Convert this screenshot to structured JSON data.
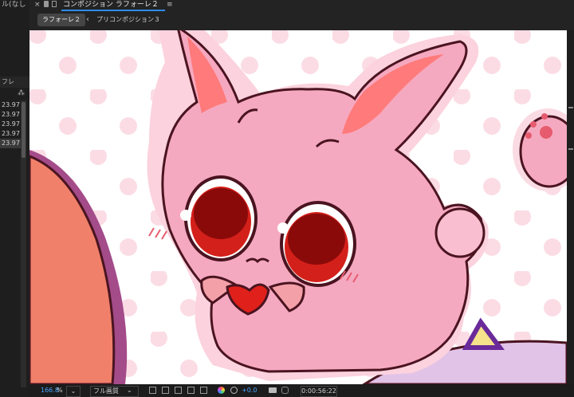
{
  "left_panel": {
    "top_text": "ル(なし",
    "column_header": "フレ",
    "fps_values": [
      "23.97",
      "23.97",
      "23.97",
      "23.97",
      "23.97"
    ]
  },
  "header": {
    "tab_title": "コンポジション ラフォーレ２",
    "breadcrumb_active": "ラフォーレ２",
    "breadcrumb_next": "プリコンポジション３"
  },
  "footer": {
    "zoom_value": "166.8",
    "zoom_unit": "%",
    "quality": "フル画質",
    "exposure_value": "+0.0",
    "timecode": "0:00:56:22"
  },
  "colors": {
    "accent": "#2d8ceb",
    "bunny_pink": "#f5a9c0",
    "eye_red": "#d4201a",
    "outline": "#5a1a2a",
    "polka_dot": "#fadbe4"
  }
}
